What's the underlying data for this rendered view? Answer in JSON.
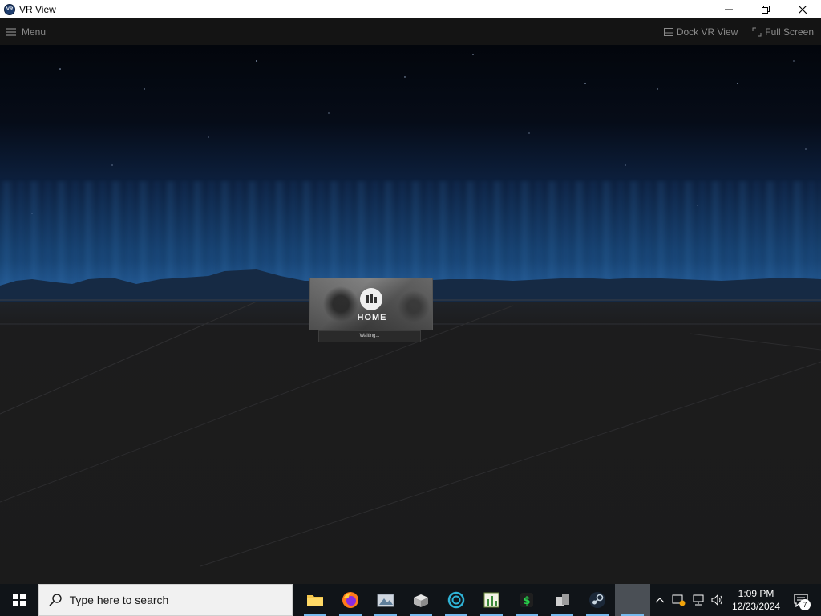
{
  "window": {
    "title": "VR View",
    "app_icon_text": "VR"
  },
  "menubar": {
    "menu_label": "Menu",
    "dock_label": "Dock VR View",
    "fullscreen_label": "Full Screen"
  },
  "vr_scene": {
    "home_label": "HOME",
    "status_text": "Waiting..."
  },
  "taskbar": {
    "search_placeholder": "Type here to search",
    "apps": [
      {
        "name": "file-explorer",
        "running": true
      },
      {
        "name": "firefox",
        "running": true
      },
      {
        "name": "app-3",
        "running": true
      },
      {
        "name": "app-4",
        "running": true
      },
      {
        "name": "app-5",
        "running": true
      },
      {
        "name": "app-6",
        "running": true
      },
      {
        "name": "app-7",
        "running": true
      },
      {
        "name": "app-8",
        "running": true
      },
      {
        "name": "steam",
        "running": true
      },
      {
        "name": "vr-view",
        "running": true,
        "active": true
      }
    ],
    "clock_time": "1:09 PM",
    "clock_date": "12/23/2024",
    "notification_count": "7"
  },
  "colors": {
    "accent": "#76b9ed",
    "menubar_bg": "#141414",
    "taskbar_bg": "#101418"
  }
}
